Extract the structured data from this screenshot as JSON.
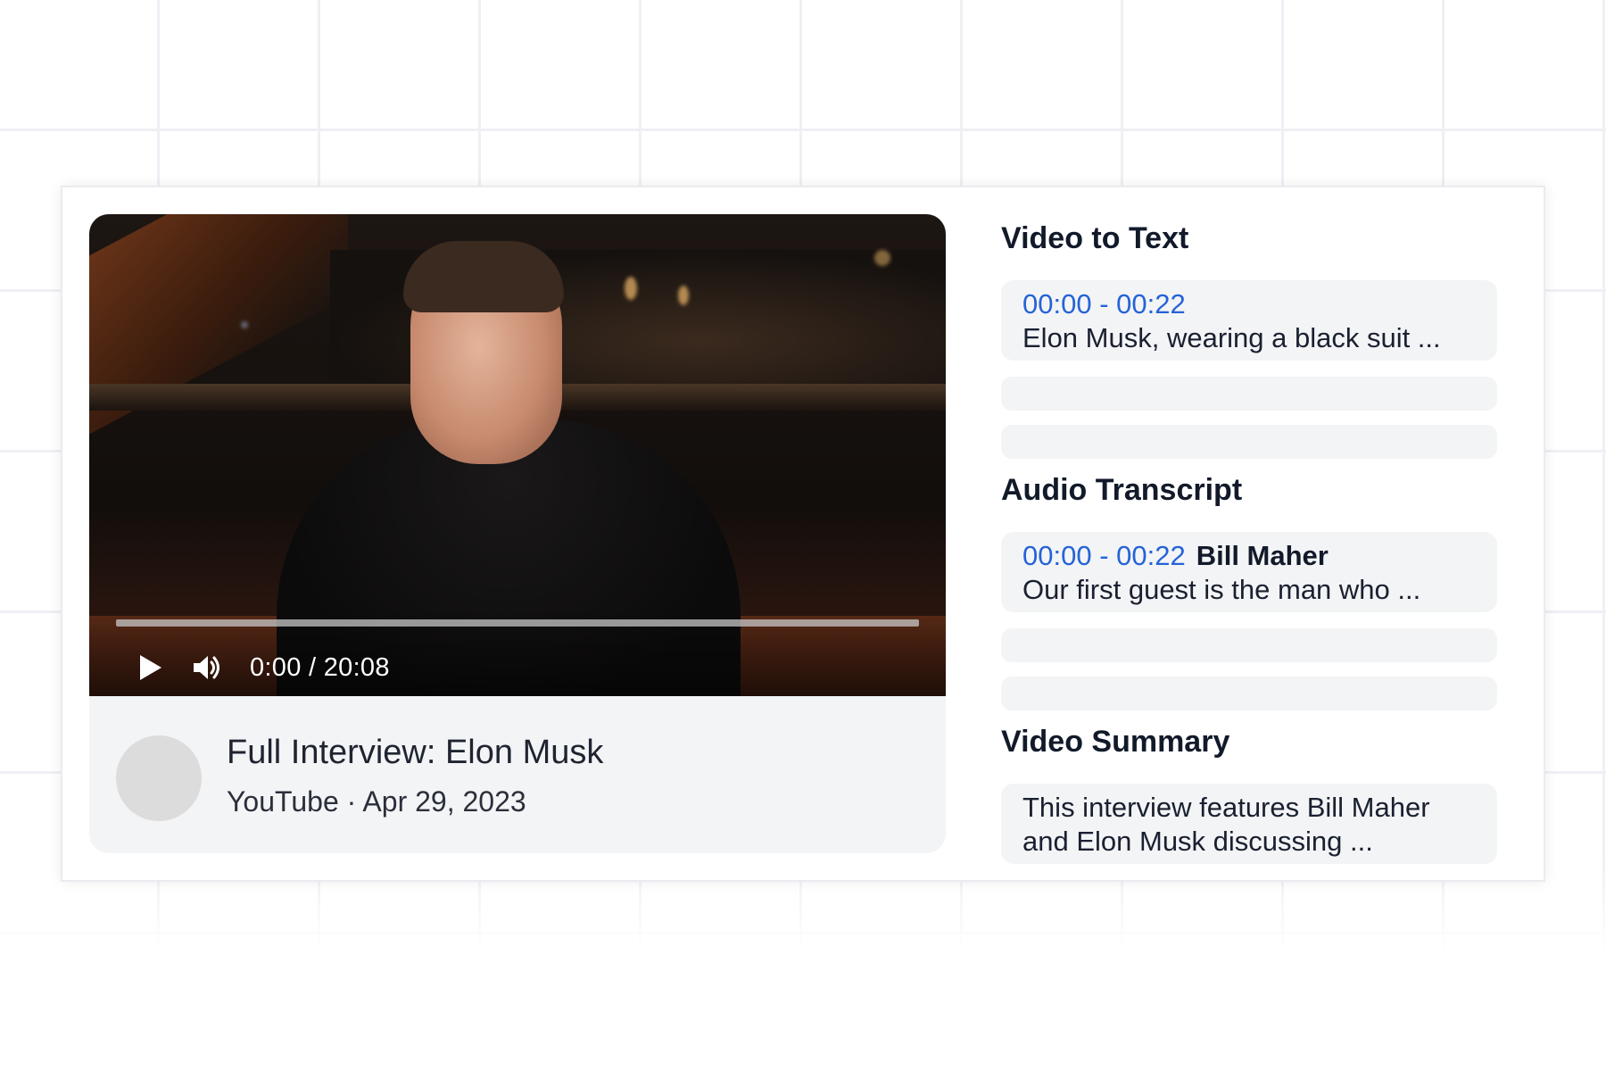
{
  "player": {
    "time": "0:00 / 20:08",
    "progress": 0,
    "title": "Full Interview: Elon Musk",
    "source": "YouTube",
    "separator": "·",
    "date": "Apr 29, 2023"
  },
  "icons": {
    "play": "play-icon",
    "volume": "volume-icon"
  },
  "sections": {
    "video_to_text": {
      "title": "Video to Text",
      "entry": {
        "timestamp": "00:00 - 00:22",
        "text": "Elon Musk, wearing a black suit ..."
      }
    },
    "audio_transcript": {
      "title": "Audio Transcript",
      "entry": {
        "timestamp": "00:00 - 00:22",
        "speaker": "Bill Maher",
        "text": "Our first guest is the man who ..."
      }
    },
    "video_summary": {
      "title": "Video Summary",
      "lines": [
        "This interview features Bill Maher",
        "and Elon Musk discussing ..."
      ]
    }
  },
  "colors": {
    "accent": "#2563d8",
    "panel_bg": "#f3f4f6",
    "heading": "#121a2a"
  }
}
